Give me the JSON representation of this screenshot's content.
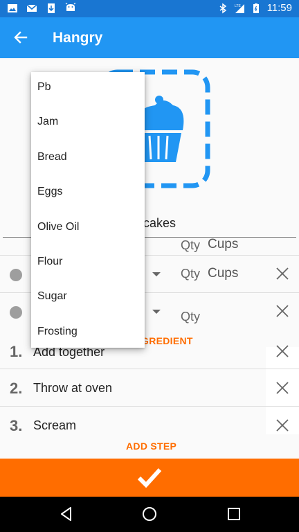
{
  "status_bar": {
    "time": "11:59",
    "left_icons": [
      "image-icon",
      "gmail-icon",
      "download-icon",
      "android-icon"
    ],
    "right_icons": [
      "bluetooth-icon",
      "lte-signal-icon",
      "battery-icon"
    ],
    "network_label": "LTE"
  },
  "app_bar": {
    "title": "Hangry",
    "back_icon": "arrow-left-icon"
  },
  "recipe": {
    "image_icon": "cupcake-icon",
    "name_visible": "cakes"
  },
  "ingredients": [
    {
      "qty_label": "Qty",
      "unit": "Cups",
      "partial": true
    },
    {
      "qty_label": "Qty",
      "unit": "Cups"
    },
    {
      "qty_label": "Qty",
      "unit": ""
    }
  ],
  "add_ingredient_visible": "GREDIENT",
  "steps": [
    {
      "number": "1.",
      "text": "Add together"
    },
    {
      "number": "2.",
      "text": "Throw at oven"
    },
    {
      "number": "3.",
      "text": "Scream"
    }
  ],
  "add_step_label": "ADD STEP",
  "dropdown": {
    "options": [
      "Pb",
      "Jam",
      "Bread",
      "Eggs",
      "Olive Oil",
      "Flour",
      "Sugar",
      "Frosting"
    ]
  },
  "save_bar": {
    "icon": "check-icon"
  },
  "nav_bar": {
    "icons": [
      "back-triangle-icon",
      "home-circle-icon",
      "recents-square-icon"
    ]
  },
  "colors": {
    "status_bar": "#1976d2",
    "app_bar": "#2196f3",
    "accent": "#ff6d00",
    "image_dash": "#2196f3"
  }
}
